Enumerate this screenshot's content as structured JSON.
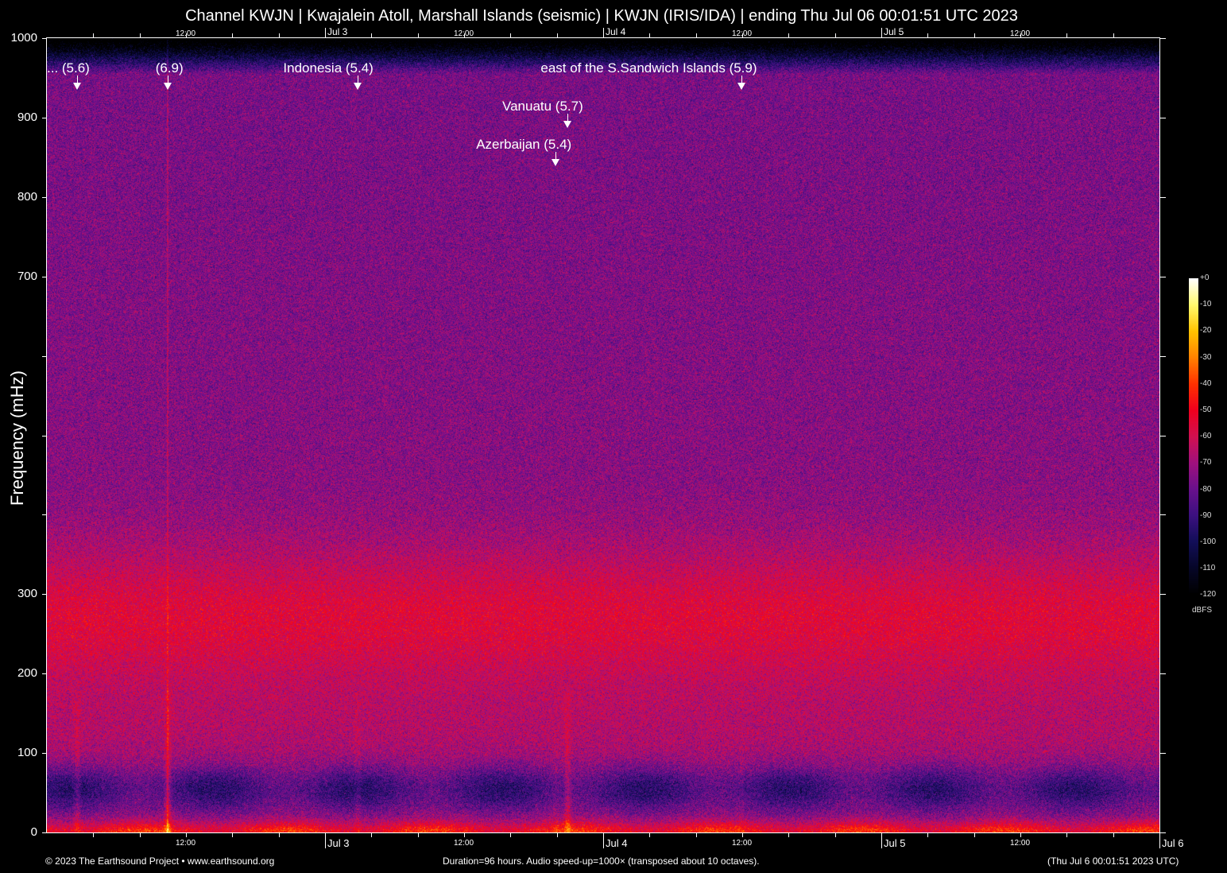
{
  "chart_data": {
    "type": "heatmap",
    "title": "Channel KWJN | Kwajalein Atoll, Marshall Islands (seismic) | KWJN (IRIS/IDA) | ending Thu Jul 06 00:01:51 UTC 2023",
    "ylabel": "Frequency (mHz)",
    "ylim": [
      0,
      1000
    ],
    "xlim_hours": [
      0,
      96
    ],
    "yticks": [
      0,
      100,
      200,
      300,
      400,
      500,
      600,
      700,
      800,
      900,
      1000
    ],
    "ytick_labels": [
      "0",
      "100",
      "200",
      "300",
      "",
      "",
      "",
      "700",
      "800",
      "900",
      "1000"
    ],
    "xticks_minor_hours": 4,
    "xtick_labels": [
      {
        "hour": 12,
        "label": "12:00",
        "kind": "time"
      },
      {
        "hour": 24,
        "label": "Jul  3",
        "kind": "day"
      },
      {
        "hour": 36,
        "label": "12:00",
        "kind": "time"
      },
      {
        "hour": 48,
        "label": "Jul  4",
        "kind": "day"
      },
      {
        "hour": 60,
        "label": "12:00",
        "kind": "time"
      },
      {
        "hour": 72,
        "label": "Jul  5",
        "kind": "day"
      },
      {
        "hour": 84,
        "label": "12:00",
        "kind": "time"
      },
      {
        "hour": 96,
        "label": "Jul  6",
        "kind": "day"
      }
    ],
    "events": [
      {
        "label": "... (5.6)",
        "hour": 2.6,
        "row": 0,
        "strength": 0.6
      },
      {
        "label": "(6.9)",
        "hour": 10.4,
        "row": 0,
        "strength": 1.0
      },
      {
        "label": "Indonesia (5.4)",
        "hour": 26.8,
        "row": 0,
        "strength": 0.35
      },
      {
        "label": "east of the S.Sandwich Islands (5.9)",
        "hour": 59.9,
        "row": 0,
        "strength": 0.2
      },
      {
        "label": "Vanuatu (5.7)",
        "hour": 44.9,
        "row": 1,
        "strength": 0.8
      },
      {
        "label": "Azerbaijan (5.4)",
        "hour": 43.9,
        "row": 2,
        "strength": 0.2
      }
    ],
    "colorbar": {
      "unit": "dBFS",
      "range": [
        -120,
        0
      ],
      "tick_labels": [
        "+0",
        "-10",
        "-20",
        "-30",
        "-40",
        "-50",
        "-60",
        "-70",
        "-80",
        "-90",
        "-100",
        "-110",
        "-120"
      ]
    }
  },
  "footer": {
    "copyright": "© 2023 The Earthsound Project • www.earthsound.org",
    "info": "Duration=96 hours. Audio speed-up=1000× (transposed about 10 octaves).",
    "end_time": "(Thu Jul  6 00:01:51 2023 UTC)"
  }
}
